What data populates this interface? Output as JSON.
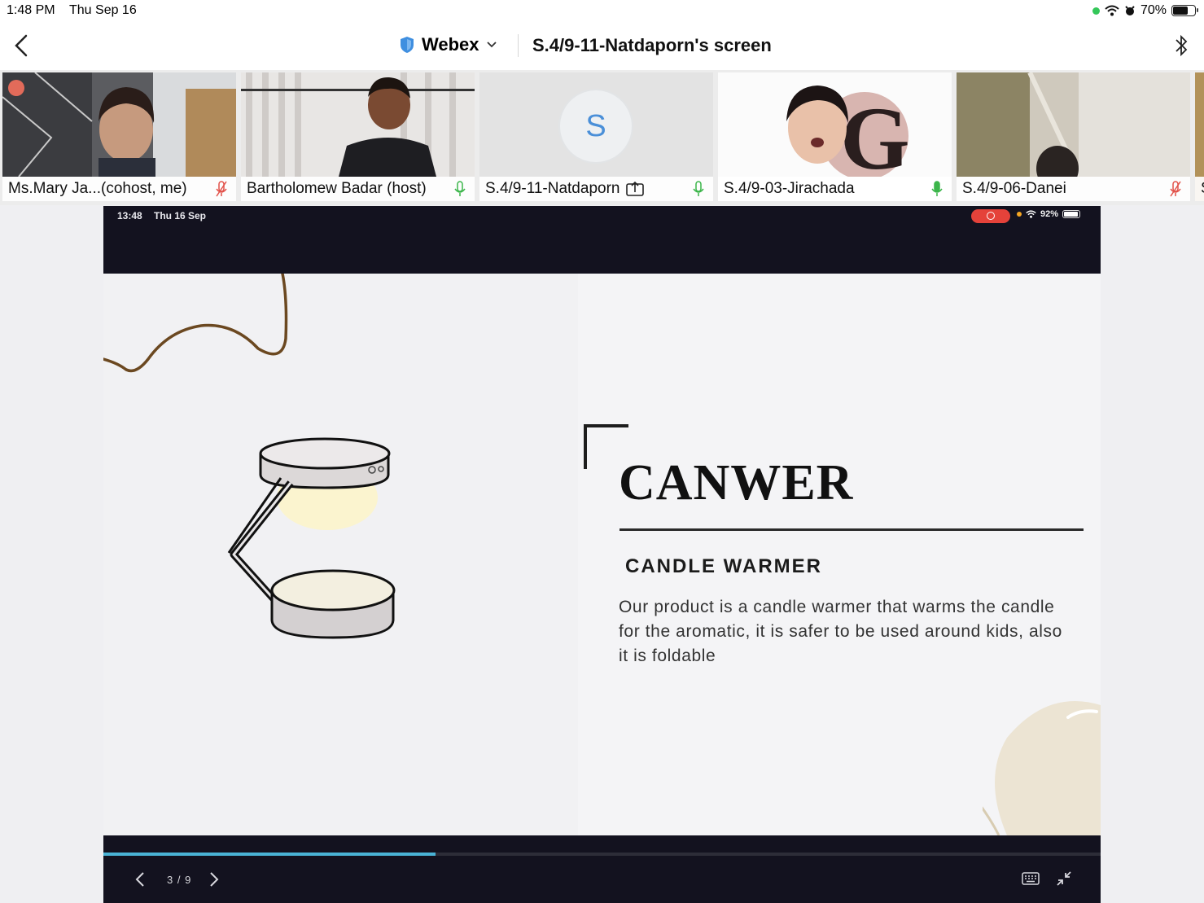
{
  "status_bar": {
    "time": "1:48 PM",
    "date": "Thu Sep 16",
    "battery": "70%",
    "battery_level": 0.7
  },
  "header": {
    "app_name": "Webex",
    "screen_title": "S.4/9-11-Natdaporn's screen"
  },
  "participants": [
    {
      "name": "Ms.Mary Ja...(cohost, me)",
      "mic": "muted"
    },
    {
      "name": "Bartholomew Badar (host)",
      "mic": "on"
    },
    {
      "name": "S.4/9-11-Natdaporn",
      "mic": "on",
      "avatar_letter": "S",
      "sharing": true
    },
    {
      "name": "S.4/9-03-Jirachada",
      "mic": "speaking"
    },
    {
      "name": "S.4/9-06-Danei",
      "mic": "muted"
    },
    {
      "name": "S",
      "mic": ""
    }
  ],
  "shared_screen": {
    "time": "13:48",
    "date": "Thu 16 Sep",
    "battery": "92%",
    "slide": {
      "brand": "CANWER",
      "subtitle": "CANDLE WARMER",
      "description": "Our product is a candle warmer that warms the candle for the aromatic, it is safer to be used around kids, also it is foldable"
    },
    "page_indicator": "3 / 9",
    "progress": 0.333
  },
  "colors": {
    "accent_blue": "#4ab3d6",
    "mic_green": "#3bb54a",
    "mic_red": "#e2524a",
    "record_red": "#e5423a"
  }
}
